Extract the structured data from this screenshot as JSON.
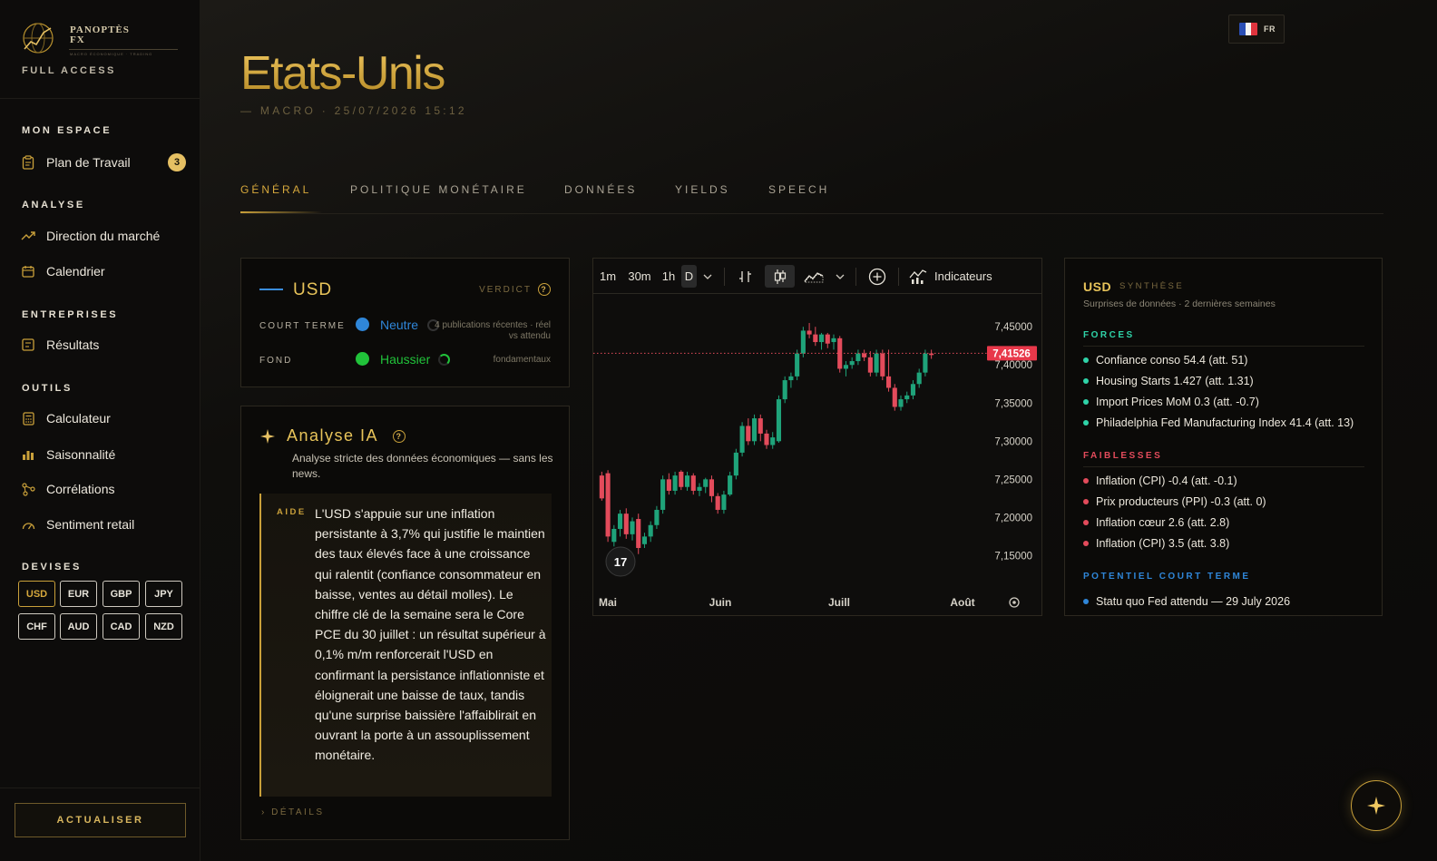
{
  "brand": {
    "name_line1": "PANOPTÈS",
    "name_line2": "FX",
    "tagline": "MACRO ÉCONOMIQUE · TRADING",
    "access": "FULL ACCESS"
  },
  "sidebar": {
    "sections": [
      {
        "title": "MON ESPACE",
        "items": [
          {
            "label": "Plan de Travail",
            "icon": "clipboard-icon",
            "badge": "3"
          }
        ]
      },
      {
        "title": "ANALYSE",
        "items": [
          {
            "label": "Direction du marché",
            "icon": "trend-icon"
          },
          {
            "label": "Calendrier",
            "icon": "calendar-icon"
          }
        ]
      },
      {
        "title": "ENTREPRISES",
        "items": [
          {
            "label": "Résultats",
            "icon": "results-icon"
          }
        ]
      },
      {
        "title": "OUTILS",
        "items": [
          {
            "label": "Calculateur",
            "icon": "calculator-icon"
          },
          {
            "label": "Saisonnalité",
            "icon": "bars-icon"
          },
          {
            "label": "Corrélations",
            "icon": "network-icon"
          },
          {
            "label": "Sentiment retail",
            "icon": "gauge-icon"
          }
        ]
      },
      {
        "title": "DEVISES",
        "items": []
      }
    ],
    "currencies": [
      "USD",
      "EUR",
      "GBP",
      "JPY",
      "CHF",
      "AUD",
      "CAD",
      "NZD"
    ],
    "active_currency": "USD",
    "refresh_label": "ACTUALISER"
  },
  "header": {
    "lang": "FR",
    "title": "Etats-Unis",
    "subtitle": "— MACRO · 25/07/2026 15:12"
  },
  "tabs": [
    "GÉNÉRAL",
    "POLITIQUE MONÉTAIRE",
    "DONNÉES",
    "YIELDS",
    "SPEECH"
  ],
  "verdict": {
    "currency": "USD",
    "label": "VERDICT",
    "short_term": {
      "label": "COURT TERME",
      "value": "Neutre",
      "color": "#2f86d8",
      "note": "4 publications récentes · réel vs attendu"
    },
    "fundamental": {
      "label": "FOND",
      "value": "Haussier",
      "color": "#21c23a",
      "note": "fondamentaux"
    }
  },
  "ai": {
    "title": "Analyse IA",
    "subtitle": "Analyse stricte des données économiques — sans les news.",
    "aide_label": "AIDE",
    "text": "L'USD s'appuie sur une inflation persistante à 3,7% qui justifie le maintien des taux élevés face à une croissance qui ralentit (confiance consommateur en baisse, ventes au détail molles). Le chiffre clé de la semaine sera le Core PCE du 30 juillet : un résultat supérieur à 0,1% m/m renforcerait l'USD en confirmant la persistance inflationniste et éloignerait une baisse de taux, tandis qu'une surprise baissière l'affaiblirait en ouvrant la porte à un assouplissement monétaire.",
    "details_label": "DÉTAILS"
  },
  "chart_toolbar": {
    "intervals": [
      "1m",
      "30m",
      "1h",
      "D"
    ],
    "selected_interval": "D",
    "indicators_label": "Indicateurs"
  },
  "chart_data": {
    "type": "candlestick",
    "x_labels": [
      "Mai",
      "Juin",
      "Juill",
      "Août"
    ],
    "y_ticks": [
      "7,45000",
      "7,40000",
      "7,35000",
      "7,30000",
      "7,25000",
      "7,20000",
      "7,15000"
    ],
    "ylim": [
      7.135,
      7.48
    ],
    "last_price": "7,41526",
    "last_value": 7.41526,
    "up_color": "#1fa37a",
    "down_color": "#e34b5b",
    "candles": [
      {
        "o": 7.255,
        "h": 7.26,
        "c": 7.225,
        "l": 7.222
      },
      {
        "o": 7.258,
        "h": 7.262,
        "c": 7.175,
        "l": 7.168
      },
      {
        "o": 7.168,
        "h": 7.19,
        "c": 7.185,
        "l": 7.162
      },
      {
        "o": 7.185,
        "h": 7.21,
        "c": 7.205,
        "l": 7.175
      },
      {
        "o": 7.205,
        "h": 7.212,
        "c": 7.178,
        "l": 7.172
      },
      {
        "o": 7.178,
        "h": 7.2,
        "c": 7.195,
        "l": 7.17
      },
      {
        "o": 7.198,
        "h": 7.205,
        "c": 7.16,
        "l": 7.152
      },
      {
        "o": 7.165,
        "h": 7.18,
        "c": 7.175,
        "l": 7.16
      },
      {
        "o": 7.175,
        "h": 7.195,
        "c": 7.19,
        "l": 7.168
      },
      {
        "o": 7.19,
        "h": 7.215,
        "c": 7.21,
        "l": 7.185
      },
      {
        "o": 7.21,
        "h": 7.255,
        "c": 7.25,
        "l": 7.205
      },
      {
        "o": 7.25,
        "h": 7.258,
        "c": 7.235,
        "l": 7.23
      },
      {
        "o": 7.235,
        "h": 7.26,
        "c": 7.255,
        "l": 7.23
      },
      {
        "o": 7.26,
        "h": 7.262,
        "c": 7.24,
        "l": 7.236
      },
      {
        "o": 7.24,
        "h": 7.26,
        "c": 7.255,
        "l": 7.235
      },
      {
        "o": 7.255,
        "h": 7.258,
        "c": 7.235,
        "l": 7.23
      },
      {
        "o": 7.235,
        "h": 7.245,
        "c": 7.24,
        "l": 7.228
      },
      {
        "o": 7.24,
        "h": 7.252,
        "c": 7.25,
        "l": 7.232
      },
      {
        "o": 7.25,
        "h": 7.255,
        "c": 7.228,
        "l": 7.22
      },
      {
        "o": 7.228,
        "h": 7.232,
        "c": 7.21,
        "l": 7.205
      },
      {
        "o": 7.21,
        "h": 7.235,
        "c": 7.23,
        "l": 7.205
      },
      {
        "o": 7.23,
        "h": 7.26,
        "c": 7.255,
        "l": 7.228
      },
      {
        "o": 7.255,
        "h": 7.29,
        "c": 7.285,
        "l": 7.25
      },
      {
        "o": 7.285,
        "h": 7.325,
        "c": 7.32,
        "l": 7.28
      },
      {
        "o": 7.32,
        "h": 7.33,
        "c": 7.3,
        "l": 7.295
      },
      {
        "o": 7.3,
        "h": 7.335,
        "c": 7.33,
        "l": 7.295
      },
      {
        "o": 7.33,
        "h": 7.335,
        "c": 7.31,
        "l": 7.3
      },
      {
        "o": 7.31,
        "h": 7.315,
        "c": 7.295,
        "l": 7.29
      },
      {
        "o": 7.295,
        "h": 7.312,
        "c": 7.305,
        "l": 7.29
      },
      {
        "o": 7.3,
        "h": 7.36,
        "c": 7.355,
        "l": 7.298
      },
      {
        "o": 7.355,
        "h": 7.385,
        "c": 7.38,
        "l": 7.35
      },
      {
        "o": 7.38,
        "h": 7.39,
        "c": 7.385,
        "l": 7.37
      },
      {
        "o": 7.385,
        "h": 7.42,
        "c": 7.415,
        "l": 7.38
      },
      {
        "o": 7.415,
        "h": 7.45,
        "c": 7.445,
        "l": 7.41
      },
      {
        "o": 7.445,
        "h": 7.455,
        "c": 7.44,
        "l": 7.435
      },
      {
        "o": 7.44,
        "h": 7.45,
        "c": 7.43,
        "l": 7.425
      },
      {
        "o": 7.43,
        "h": 7.442,
        "c": 7.44,
        "l": 7.42
      },
      {
        "o": 7.44,
        "h": 7.442,
        "c": 7.428,
        "l": 7.422
      },
      {
        "o": 7.43,
        "h": 7.44,
        "c": 7.435,
        "l": 7.42
      },
      {
        "o": 7.435,
        "h": 7.438,
        "c": 7.395,
        "l": 7.39
      },
      {
        "o": 7.395,
        "h": 7.405,
        "c": 7.4,
        "l": 7.385
      },
      {
        "o": 7.4,
        "h": 7.41,
        "c": 7.405,
        "l": 7.395
      },
      {
        "o": 7.405,
        "h": 7.42,
        "c": 7.415,
        "l": 7.4
      },
      {
        "o": 7.415,
        "h": 7.42,
        "c": 7.41,
        "l": 7.405
      },
      {
        "o": 7.41,
        "h": 7.418,
        "c": 7.39,
        "l": 7.385
      },
      {
        "o": 7.39,
        "h": 7.42,
        "c": 7.415,
        "l": 7.385
      },
      {
        "o": 7.415,
        "h": 7.42,
        "c": 7.385,
        "l": 7.38
      },
      {
        "o": 7.385,
        "h": 7.42,
        "c": 7.37,
        "l": 7.365
      },
      {
        "o": 7.37,
        "h": 7.375,
        "c": 7.345,
        "l": 7.34
      },
      {
        "o": 7.345,
        "h": 7.36,
        "c": 7.355,
        "l": 7.34
      },
      {
        "o": 7.355,
        "h": 7.365,
        "c": 7.36,
        "l": 7.35
      },
      {
        "o": 7.36,
        "h": 7.38,
        "c": 7.375,
        "l": 7.355
      },
      {
        "o": 7.375,
        "h": 7.395,
        "c": 7.39,
        "l": 7.37
      },
      {
        "o": 7.39,
        "h": 7.42,
        "c": 7.415,
        "l": 7.385
      },
      {
        "o": 7.415,
        "h": 7.42,
        "c": 7.413,
        "l": 7.408
      }
    ]
  },
  "synthese": {
    "currency": "USD",
    "tag": "SYNTHÈSE",
    "subtitle": "Surprises de données · 2 dernières semaines",
    "forces_title": "FORCES",
    "forces": [
      "Confiance conso 54.4 (att. 51)",
      "Housing Starts 1.427 (att. 1.31)",
      "Import Prices MoM 0.3 (att. -0.7)",
      "Philadelphia Fed Manufacturing Index 41.4 (att. 13)"
    ],
    "weak_title": "FAIBLESSES",
    "weaknesses": [
      "Inflation (CPI) -0.4 (att. -0.1)",
      "Prix producteurs (PPI) -0.3 (att. 0)",
      "Inflation cœur 2.6 (att. 2.8)",
      "Inflation (CPI) 3.5 (att. 3.8)"
    ],
    "potential_title": "POTENTIEL COURT TERME",
    "potential": [
      "Statu quo Fed attendu — 29 July 2026"
    ],
    "colors": {
      "force": "#2fd3a8",
      "weak": "#e34b5b",
      "potential": "#2f86d8",
      "forces_title": "#2fd3a8",
      "weak_title": "#e34b5b",
      "potential_title": "#2f86d8"
    }
  }
}
